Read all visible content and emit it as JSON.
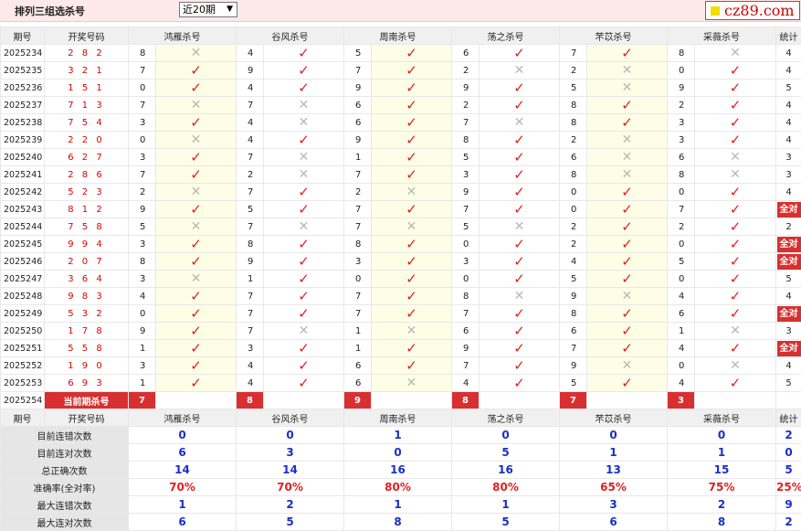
{
  "header": {
    "title": "排列三组选杀号",
    "select_value": "近20期",
    "logo_text": "cz89.com"
  },
  "columns": {
    "period": "期号",
    "draw": "开奖号码",
    "experts": [
      "鸿雁杀号",
      "谷风杀号",
      "周南杀号",
      "荡之杀号",
      "芣苡杀号",
      "采薇杀号"
    ],
    "stat": "统计"
  },
  "rows": [
    {
      "p": "2025234",
      "d": "2 8 2",
      "k": [
        [
          "8",
          0
        ],
        [
          "4",
          1
        ],
        [
          "5",
          1
        ],
        [
          "6",
          1
        ],
        [
          "7",
          1
        ],
        [
          "8",
          0
        ]
      ],
      "s": "4"
    },
    {
      "p": "2025235",
      "d": "3 2 1",
      "k": [
        [
          "7",
          1
        ],
        [
          "9",
          1
        ],
        [
          "7",
          1
        ],
        [
          "2",
          0
        ],
        [
          "2",
          0
        ],
        [
          "0",
          1
        ]
      ],
      "s": "4"
    },
    {
      "p": "2025236",
      "d": "1 5 1",
      "k": [
        [
          "0",
          1
        ],
        [
          "4",
          1
        ],
        [
          "9",
          1
        ],
        [
          "9",
          1
        ],
        [
          "5",
          0
        ],
        [
          "9",
          1
        ]
      ],
      "s": "5"
    },
    {
      "p": "2025237",
      "d": "7 1 3",
      "k": [
        [
          "7",
          0
        ],
        [
          "7",
          0
        ],
        [
          "6",
          1
        ],
        [
          "2",
          1
        ],
        [
          "8",
          1
        ],
        [
          "2",
          1
        ]
      ],
      "s": "4"
    },
    {
      "p": "2025238",
      "d": "7 5 4",
      "k": [
        [
          "3",
          1
        ],
        [
          "4",
          0
        ],
        [
          "6",
          1
        ],
        [
          "7",
          0
        ],
        [
          "8",
          1
        ],
        [
          "3",
          1
        ]
      ],
      "s": "4"
    },
    {
      "p": "2025239",
      "d": "2 2 0",
      "k": [
        [
          "0",
          0
        ],
        [
          "4",
          1
        ],
        [
          "9",
          1
        ],
        [
          "8",
          1
        ],
        [
          "2",
          0
        ],
        [
          "3",
          1
        ]
      ],
      "s": "4"
    },
    {
      "p": "2025240",
      "d": "6 2 7",
      "k": [
        [
          "3",
          1
        ],
        [
          "7",
          0
        ],
        [
          "1",
          1
        ],
        [
          "5",
          1
        ],
        [
          "6",
          0
        ],
        [
          "6",
          0
        ]
      ],
      "s": "3"
    },
    {
      "p": "2025241",
      "d": "2 8 6",
      "k": [
        [
          "7",
          1
        ],
        [
          "2",
          0
        ],
        [
          "7",
          1
        ],
        [
          "3",
          1
        ],
        [
          "8",
          0
        ],
        [
          "8",
          0
        ]
      ],
      "s": "3"
    },
    {
      "p": "2025242",
      "d": "5 2 3",
      "k": [
        [
          "2",
          0
        ],
        [
          "7",
          1
        ],
        [
          "2",
          0
        ],
        [
          "9",
          1
        ],
        [
          "0",
          1
        ],
        [
          "0",
          1
        ]
      ],
      "s": "4"
    },
    {
      "p": "2025243",
      "d": "8 1 2",
      "k": [
        [
          "9",
          1
        ],
        [
          "5",
          1
        ],
        [
          "7",
          1
        ],
        [
          "7",
          1
        ],
        [
          "0",
          1
        ],
        [
          "7",
          1
        ]
      ],
      "s": "全对"
    },
    {
      "p": "2025244",
      "d": "7 5 8",
      "k": [
        [
          "5",
          0
        ],
        [
          "7",
          0
        ],
        [
          "7",
          0
        ],
        [
          "5",
          0
        ],
        [
          "2",
          1
        ],
        [
          "2",
          1
        ]
      ],
      "s": "2"
    },
    {
      "p": "2025245",
      "d": "9 9 4",
      "k": [
        [
          "3",
          1
        ],
        [
          "8",
          1
        ],
        [
          "8",
          1
        ],
        [
          "0",
          1
        ],
        [
          "2",
          1
        ],
        [
          "0",
          1
        ]
      ],
      "s": "全对"
    },
    {
      "p": "2025246",
      "d": "2 0 7",
      "k": [
        [
          "8",
          1
        ],
        [
          "9",
          1
        ],
        [
          "3",
          1
        ],
        [
          "3",
          1
        ],
        [
          "4",
          1
        ],
        [
          "5",
          1
        ]
      ],
      "s": "全对"
    },
    {
      "p": "2025247",
      "d": "3 6 4",
      "k": [
        [
          "3",
          0
        ],
        [
          "1",
          1
        ],
        [
          "0",
          1
        ],
        [
          "0",
          1
        ],
        [
          "5",
          1
        ],
        [
          "0",
          1
        ]
      ],
      "s": "5"
    },
    {
      "p": "2025248",
      "d": "9 8 3",
      "k": [
        [
          "4",
          1
        ],
        [
          "7",
          1
        ],
        [
          "7",
          1
        ],
        [
          "8",
          0
        ],
        [
          "9",
          0
        ],
        [
          "4",
          1
        ]
      ],
      "s": "4"
    },
    {
      "p": "2025249",
      "d": "5 3 2",
      "k": [
        [
          "0",
          1
        ],
        [
          "7",
          1
        ],
        [
          "7",
          1
        ],
        [
          "7",
          1
        ],
        [
          "8",
          1
        ],
        [
          "6",
          1
        ]
      ],
      "s": "全对"
    },
    {
      "p": "2025250",
      "d": "1 7 8",
      "k": [
        [
          "9",
          1
        ],
        [
          "7",
          0
        ],
        [
          "1",
          0
        ],
        [
          "6",
          1
        ],
        [
          "6",
          1
        ],
        [
          "1",
          0
        ]
      ],
      "s": "3"
    },
    {
      "p": "2025251",
      "d": "5 5 8",
      "k": [
        [
          "1",
          1
        ],
        [
          "3",
          1
        ],
        [
          "1",
          1
        ],
        [
          "9",
          1
        ],
        [
          "7",
          1
        ],
        [
          "4",
          1
        ]
      ],
      "s": "全对"
    },
    {
      "p": "2025252",
      "d": "1 9 0",
      "k": [
        [
          "3",
          1
        ],
        [
          "4",
          1
        ],
        [
          "6",
          1
        ],
        [
          "7",
          1
        ],
        [
          "9",
          0
        ],
        [
          "0",
          0
        ]
      ],
      "s": "4"
    },
    {
      "p": "2025253",
      "d": "6 9 3",
      "k": [
        [
          "1",
          1
        ],
        [
          "4",
          1
        ],
        [
          "6",
          0
        ],
        [
          "4",
          1
        ],
        [
          "5",
          1
        ],
        [
          "4",
          1
        ]
      ],
      "s": "5"
    }
  ],
  "current": {
    "p": "2025254",
    "label": "当前期杀号",
    "kills": [
      "7",
      "8",
      "9",
      "8",
      "7",
      "3"
    ]
  },
  "stats": [
    {
      "label": "目前连错次数",
      "values": [
        "0",
        "0",
        "1",
        "0",
        "0",
        "0",
        "2"
      ]
    },
    {
      "label": "目前连对次数",
      "values": [
        "6",
        "3",
        "0",
        "5",
        "1",
        "1",
        "0"
      ]
    },
    {
      "label": "总正确次数",
      "values": [
        "14",
        "14",
        "16",
        "16",
        "13",
        "15",
        "5"
      ]
    },
    {
      "label": "准确率(全对率)",
      "values": [
        "70%",
        "70%",
        "80%",
        "80%",
        "65%",
        "75%",
        "25%"
      ]
    },
    {
      "label": "最大连错次数",
      "values": [
        "1",
        "2",
        "1",
        "1",
        "3",
        "2",
        "9"
      ]
    },
    {
      "label": "最大连对次数",
      "values": [
        "6",
        "5",
        "8",
        "5",
        "6",
        "8",
        "2"
      ]
    }
  ],
  "icons": {
    "correct": "check-icon",
    "wrong": "cross-icon"
  },
  "colors": {
    "accent": "#d83030",
    "correct": "#e02020",
    "stat_blue": "#1a2fc8"
  }
}
